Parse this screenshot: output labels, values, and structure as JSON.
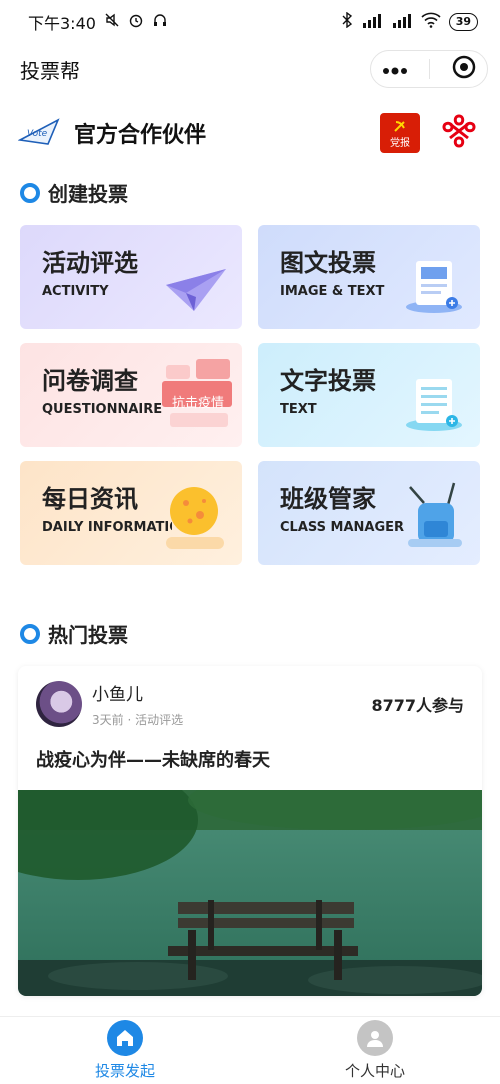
{
  "status": {
    "time": "下午3:40",
    "battery": "39"
  },
  "nav": {
    "title": "投票帮"
  },
  "partners": {
    "title": "官方合作伙伴",
    "dang_logo_text": "党报"
  },
  "create": {
    "section_title": "创建投票",
    "cards": [
      {
        "title": "活动评选",
        "sub": "ACTIVITY"
      },
      {
        "title": "图文投票",
        "sub": "IMAGE & TEXT"
      },
      {
        "title": "问卷调查",
        "sub": "QUESTIONNAIRE",
        "tag": "抗击疫情"
      },
      {
        "title": "文字投票",
        "sub": "TEXT"
      },
      {
        "title": "每日资讯",
        "sub": "DAILY INFORMATIO"
      },
      {
        "title": "班级管家",
        "sub": "CLASS MANAGER"
      }
    ]
  },
  "hot": {
    "section_title": "热门投票",
    "post": {
      "user": "小鱼儿",
      "meta": "3天前 · 活动评选",
      "count": "8777人参与",
      "title": "战疫心为伴——未缺席的春天"
    }
  },
  "tabbar": {
    "tab1": "投票发起",
    "tab2": "个人中心"
  },
  "colors": {
    "accent": "#1e88e5"
  },
  "icons": [
    "wifi-icon",
    "bluetooth-icon",
    "alarm-icon",
    "headphone-icon",
    "more-icon",
    "close-target-icon",
    "vote-logo-icon",
    "unicom-logo-icon",
    "paper-plane-icon",
    "document-add-icon",
    "moon-icon",
    "backpack-icon",
    "home-icon",
    "user-icon"
  ]
}
